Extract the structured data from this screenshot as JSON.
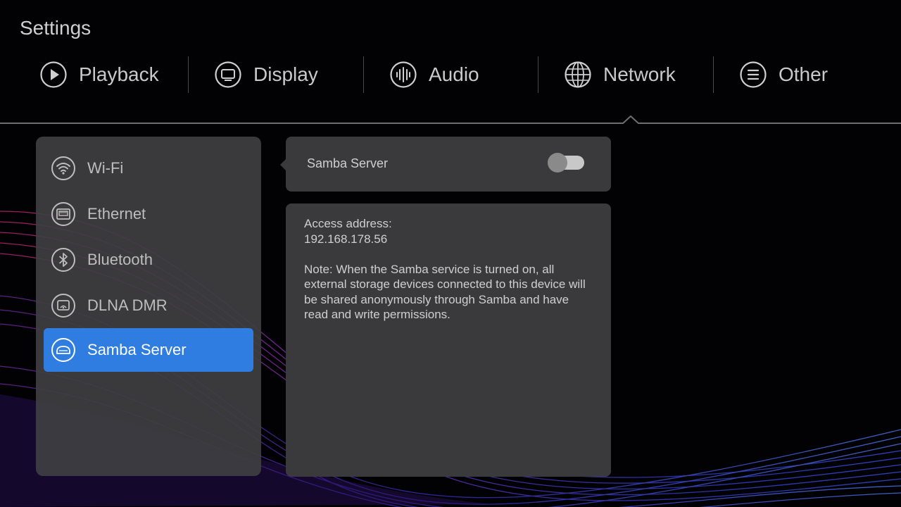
{
  "window": {
    "title": "Settings"
  },
  "tabs": [
    {
      "label": "Playback",
      "icon": "play-circle-icon"
    },
    {
      "label": "Display",
      "icon": "monitor-icon"
    },
    {
      "label": "Audio",
      "icon": "audio-wave-icon"
    },
    {
      "label": "Network",
      "icon": "globe-icon",
      "selected": true
    },
    {
      "label": "Other",
      "icon": "menu-lines-icon"
    }
  ],
  "sidebar": {
    "items": [
      {
        "label": "Wi-Fi",
        "icon": "wifi-icon"
      },
      {
        "label": "Ethernet",
        "icon": "ethernet-icon"
      },
      {
        "label": "Bluetooth",
        "icon": "bluetooth-icon"
      },
      {
        "label": "DLNA DMR",
        "icon": "dlna-icon"
      },
      {
        "label": "Samba Server",
        "icon": "samba-icon",
        "active": true
      }
    ]
  },
  "samba": {
    "toggle_label": "Samba Server",
    "enabled": false,
    "address_label": "Access address:",
    "address": "192.168.178.56",
    "note": "Note: When the Samba service is turned on, all external storage devices connected to this device will be shared anonymously through Samba and have read and write permissions."
  },
  "colors": {
    "accent": "#2f7de1",
    "panel": "#3a3a3d",
    "background": "#020204"
  }
}
